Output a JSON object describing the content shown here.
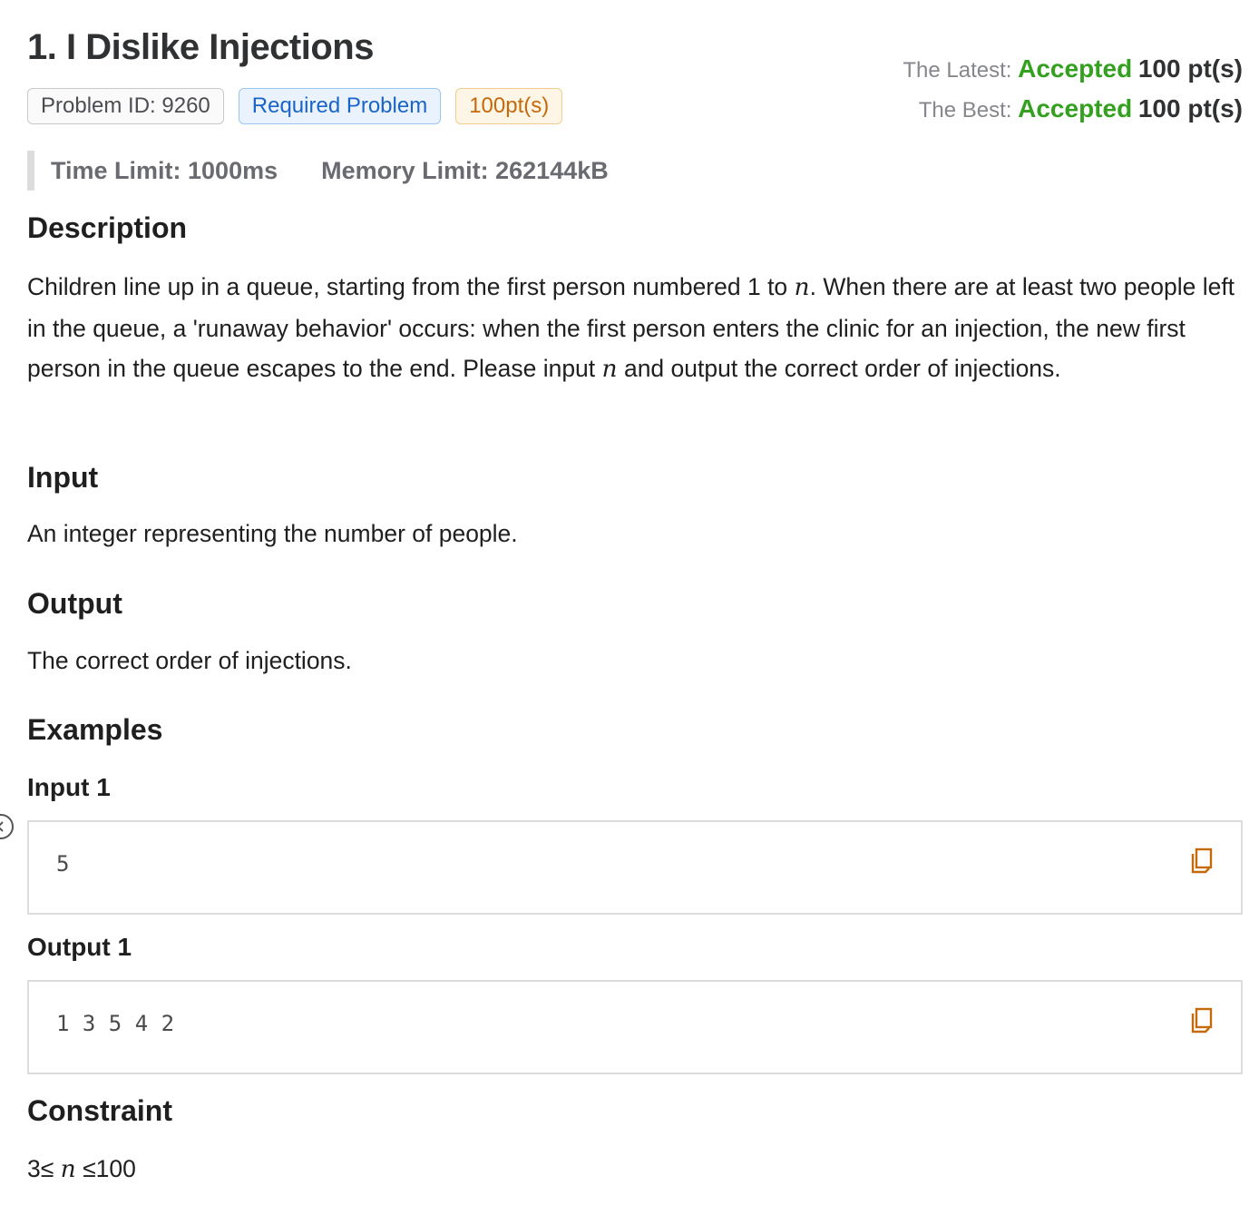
{
  "problem": {
    "title": "1.  I Dislike Injections",
    "tags": {
      "id": "Problem ID: 9260",
      "required": "Required Problem",
      "points": "100pt(s)"
    },
    "status": {
      "latest_label": "The Latest:",
      "latest_result": "Accepted",
      "latest_points": "100 pt(s)",
      "best_label": "The Best:",
      "best_result": "Accepted",
      "best_points": "100 pt(s)"
    },
    "limits": {
      "time": "Time Limit: 1000ms",
      "memory": "Memory Limit: 262144kB"
    }
  },
  "sections": {
    "description_heading": "Description",
    "description": {
      "part1": "Children line up in a queue, starting from the first person numbered 1 to ",
      "var1": "n",
      "part2": ". When there are at least two people left in the queue, a 'runaway behavior' occurs: when the first person enters the clinic for an injection, the new first person in the queue escapes to the end. Please input ",
      "var2": "n",
      "part3": " and output the correct order of injections."
    },
    "input_heading": "Input",
    "input_text": "An integer representing the number of people.",
    "output_heading": "Output",
    "output_text": "The correct order of injections.",
    "examples_heading": "Examples",
    "examples": {
      "input_label": "Input 1",
      "input_value": "5",
      "output_label": "Output 1",
      "output_value": "1 3 5 4 2"
    },
    "constraint_heading": "Constraint",
    "constraint": {
      "left": "3≤ ",
      "var": "n",
      "right": " ≤100"
    }
  },
  "colors": {
    "accepted": "#33a11f",
    "copy_icon": "#c5690a",
    "tag_blue": "#1a64c7",
    "tag_orange": "#c5690a"
  },
  "icons": {
    "copy": "copy-icon",
    "side_handle": "collapse-handle-icon"
  }
}
